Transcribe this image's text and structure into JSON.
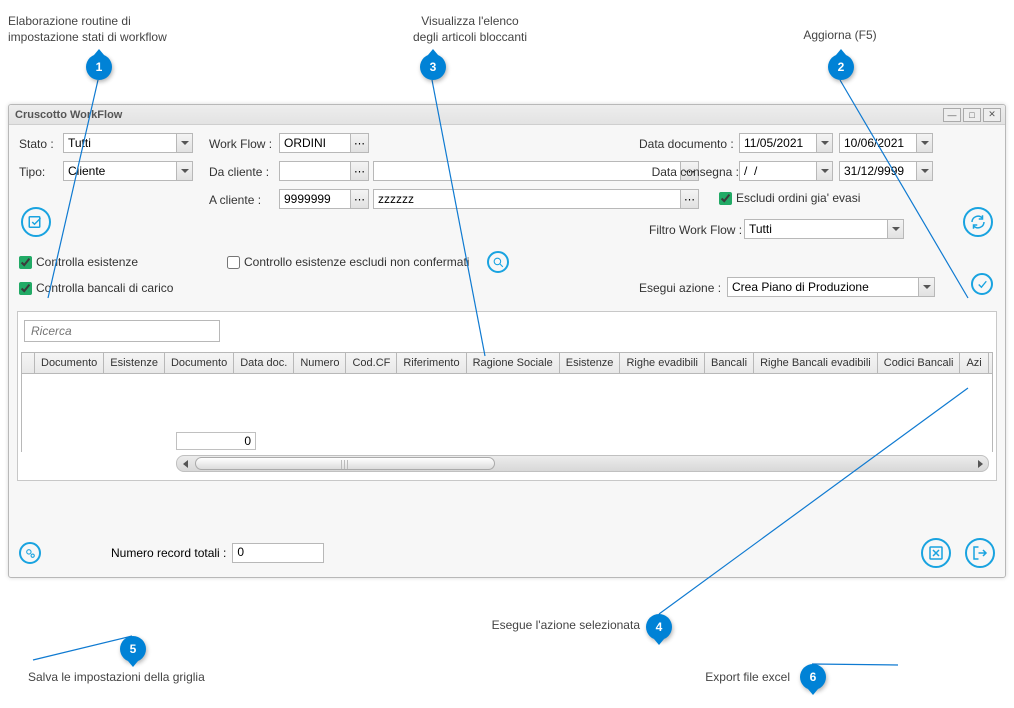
{
  "annotations": {
    "a1": {
      "num": "1",
      "label": "Elaborazione routine di\nimpostazione stati di workflow"
    },
    "a2": {
      "num": "2",
      "label": "Aggiorna (F5)"
    },
    "a3": {
      "num": "3",
      "label": "Visualizza l'elenco\ndegli articoli bloccanti"
    },
    "a4": {
      "num": "4",
      "label": "Esegue l'azione selezionata"
    },
    "a5": {
      "num": "5",
      "label": "Salva le impostazioni della griglia"
    },
    "a6": {
      "num": "6",
      "label": "Export file excel"
    }
  },
  "window": {
    "title": "Cruscotto WorkFlow"
  },
  "filters": {
    "stato_label": "Stato :",
    "stato_value": "Tutti",
    "tipo_label": "Tipo:",
    "tipo_value": "Cliente",
    "workflow_label": "Work Flow :",
    "workflow_value": "ORDINI",
    "dacliente_label": "Da cliente :",
    "dacliente_value": "",
    "acliente_label": "A cliente :",
    "acliente_value": "9999999",
    "acliente_text": "zzzzzz",
    "datadoc_label": "Data documento :",
    "datadoc_from": "11/05/2021",
    "datadoc_to": "10/06/2021",
    "datacons_label": "Data consegna :",
    "datacons_from": "/  /",
    "datacons_to": "31/12/9999",
    "escludi_label": "Escludi ordini gia' evasi",
    "filtrowf_label": "Filtro Work Flow :",
    "filtrowf_value": "Tutti",
    "controlla_esistenze": "Controlla esistenze",
    "controllo_escludi": "Controllo esistenze escludi non confermati",
    "controlla_bancali": "Controlla bancali di carico",
    "esegui_azione_label": "Esegui azione :",
    "esegui_azione_value": "Crea Piano di Produzione"
  },
  "search": {
    "placeholder": "Ricerca"
  },
  "grid": {
    "columns": [
      "",
      "Documento",
      "Esistenze",
      "Documento",
      "Data doc.",
      "Numero",
      "Cod.CF",
      "Riferimento",
      "Ragione Sociale",
      "Esistenze",
      "Righe evadibili",
      "Bancali",
      "Righe Bancali evadibili",
      "Codici Bancali",
      "Azi"
    ],
    "footer_val": "0"
  },
  "footer": {
    "record_label": "Numero record totali :",
    "record_value": "0"
  }
}
